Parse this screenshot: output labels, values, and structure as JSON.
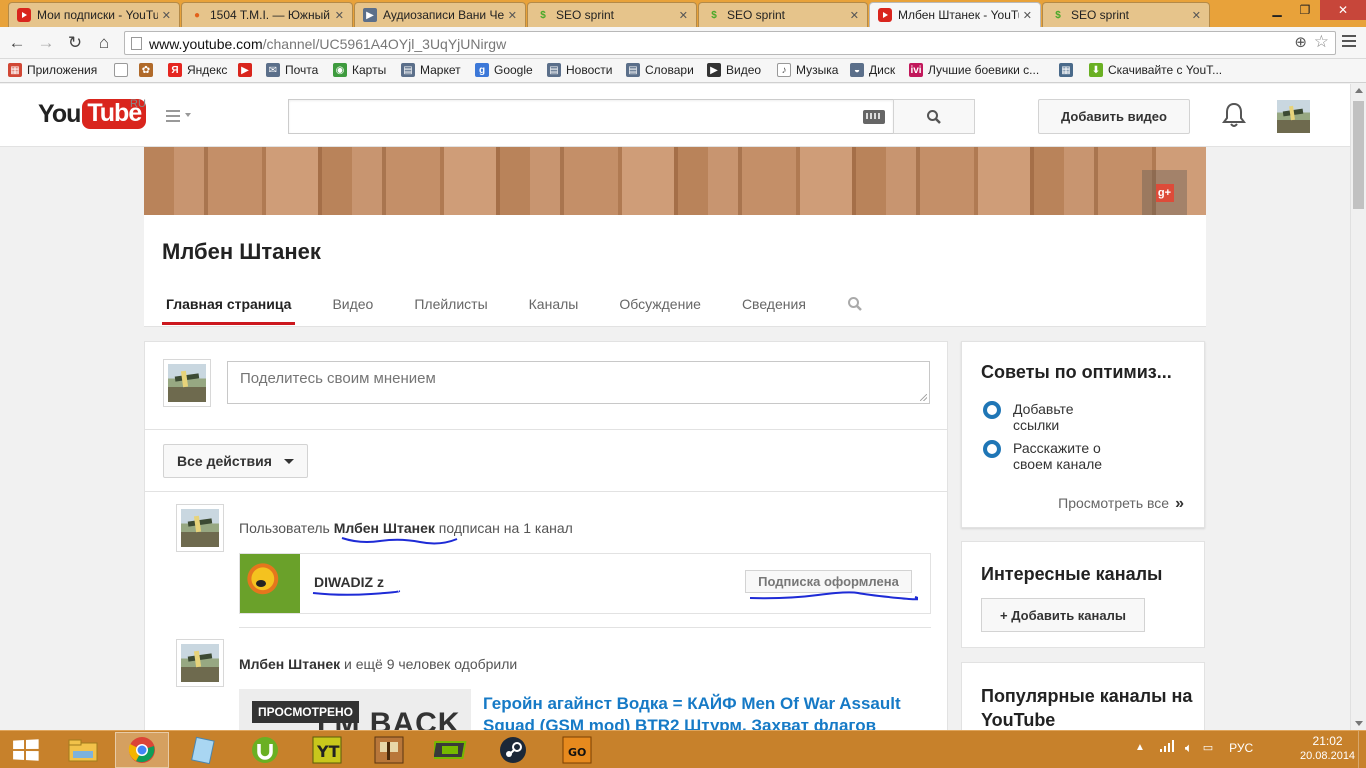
{
  "browser": {
    "tabs": [
      {
        "title": "Мои подписки - YouTube",
        "favicon": "youtube-icon",
        "active": false
      },
      {
        "title": "1504 T.M.I. — Южный",
        "favicon": "firefox-icon",
        "active": false
      },
      {
        "title": "Аудиозаписи Вани Че",
        "favicon": "play-icon",
        "active": false
      },
      {
        "title": "SEO sprint",
        "favicon": "seosprint-icon",
        "active": false
      },
      {
        "title": "SEO sprint",
        "favicon": "seosprint-icon",
        "active": false
      },
      {
        "title": "Млбен Штанек - YouTube",
        "favicon": "youtube-icon",
        "active": true
      },
      {
        "title": "SEO sprint",
        "favicon": "seosprint-icon",
        "active": false
      }
    ],
    "url_host": "www.youtube.com",
    "url_path": "/channel/UC5961A4OYjl_3UqYjUNirgw",
    "bookmarks": [
      {
        "label": "Приложения",
        "icon": "apps-icon",
        "color": "#d14836"
      },
      {
        "label": "",
        "icon": "page-icon",
        "color": "#ffffff"
      },
      {
        "label": "",
        "icon": "puzzle-icon",
        "color": "#b06a2a"
      },
      {
        "label": "Яндекс",
        "icon": "yandex-icon",
        "color": "#e52620"
      },
      {
        "label": "",
        "icon": "youtube-icon",
        "color": "#d9251d"
      },
      {
        "label": "Почта",
        "icon": "mail-icon",
        "color": "#5b6f8a"
      },
      {
        "label": "Карты",
        "icon": "maps-icon",
        "color": "#3e9b3e"
      },
      {
        "label": "Маркет",
        "icon": "market-icon",
        "color": "#5b6f8a"
      },
      {
        "label": "Google",
        "icon": "google-icon",
        "color": "#3c78d8"
      },
      {
        "label": "Новости",
        "icon": "news-icon",
        "color": "#5b6f8a"
      },
      {
        "label": "Словари",
        "icon": "dictionary-icon",
        "color": "#5b6f8a"
      },
      {
        "label": "Видео",
        "icon": "video-icon",
        "color": "#333333"
      },
      {
        "label": "Музыка",
        "icon": "music-icon",
        "color": "#ffffff"
      },
      {
        "label": "Диск",
        "icon": "disk-icon",
        "color": "#5b6f8a"
      },
      {
        "label": "Лучшие боевики с...",
        "icon": "ivi-icon",
        "color": "#c2185b"
      },
      {
        "label": "",
        "icon": "film-icon",
        "color": "#4a6a8a"
      },
      {
        "label": "Скачивайте с YouT...",
        "icon": "download-icon",
        "color": "#6ab023"
      }
    ]
  },
  "youtube": {
    "logo_you": "You",
    "logo_tube": "Tube",
    "logo_region": "RU",
    "search_placeholder": "",
    "upload_label": "Добавить видео"
  },
  "channel": {
    "name": "Млбен Штанек",
    "tabs": [
      {
        "label": "Главная страница",
        "active": true
      },
      {
        "label": "Видео",
        "active": false
      },
      {
        "label": "Плейлисты",
        "active": false
      },
      {
        "label": "Каналы",
        "active": false
      },
      {
        "label": "Обсуждение",
        "active": false
      },
      {
        "label": "Сведения",
        "active": false
      }
    ]
  },
  "feed": {
    "share_placeholder": "Поделитесь своим мнением",
    "actions_label": "Все действия",
    "activity1": {
      "prefix": "Пользователь ",
      "user": "Млбен Штанек",
      "suffix": " подписан на 1 канал",
      "channel_name": "DIWADIZ z",
      "subscribed_label": "Подписка оформлена"
    },
    "activity2": {
      "user": "Млбен Штанек",
      "suffix": " и ещё 9 человек одобрили",
      "watched_badge": "ПРОСМОТРЕНО",
      "thumb_text": "I'M BACK",
      "video_title": "Геройн агайнст Водка = КАЙФ Men Of War Assault Squad (GSM mod) BTR2 Штурм. Захват флагов"
    }
  },
  "sidebar": {
    "tips_title": "Советы по оптимиз...",
    "tips": [
      "Добавьте ссылки",
      "Расскажите о своем канале"
    ],
    "tips_more": "Просмотреть все",
    "tips_more_arrow": "»",
    "interesting_title": "Интересные каналы",
    "add_channels_label": "+ Добавить каналы",
    "popular_title": "Популярные каналы на YouTube"
  },
  "taskbar": {
    "apps": [
      "explorer-icon",
      "chrome-icon",
      "notepad-icon",
      "utorrent-icon",
      "game-yt-icon",
      "game-pirates-icon",
      "nvidia-icon",
      "steam-icon",
      "csgo-icon"
    ],
    "active_app": "chrome-icon",
    "language": "РУС",
    "time": "21:02",
    "date": "20.08.2014"
  },
  "colors": {
    "youtube_red": "#cc181e",
    "link_blue": "#167ac6",
    "taskbar": "#c7812b",
    "tip_ring": "#1f76b6"
  }
}
